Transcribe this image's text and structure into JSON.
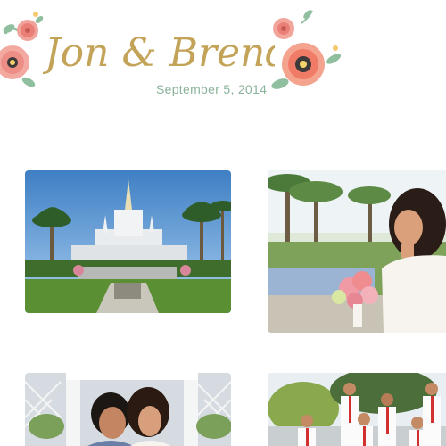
{
  "header": {
    "title": "Jon & Brenda",
    "date": "September 5, 2014"
  },
  "gallery": {
    "photos": [
      {
        "name": "temple-photo",
        "alt": "Temple with gardens and palm trees"
      },
      {
        "name": "bride-bouquet-photo",
        "alt": "Bride holding pink rose bouquet"
      },
      {
        "name": "bride-with-mother-photo",
        "alt": "Bride with older woman under white pergola"
      },
      {
        "name": "groomsmen-photo",
        "alt": "Groomsmen in white shirts with red ties"
      }
    ]
  },
  "colors": {
    "title_gold": "#c3a357",
    "date_green": "#8ab39a",
    "flower_pink": "#ef8f87",
    "flower_coral": "#f26b5b",
    "leaf_green": "#8fbf9f"
  }
}
